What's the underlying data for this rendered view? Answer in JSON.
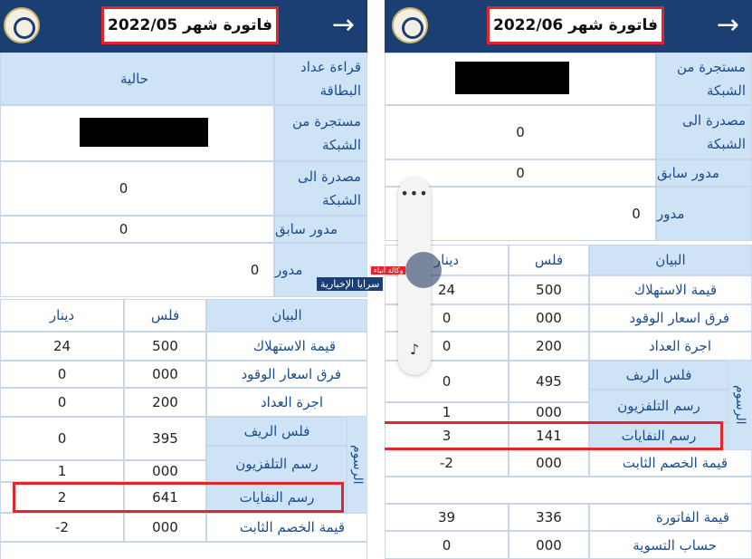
{
  "left": {
    "title": "فاتورة شهر 2022/05",
    "meter_reading_label": "قراءة عداد البطاقة",
    "meter_reading_value": "حالية",
    "consumed_label": "مستجرة من الشبكة",
    "exported_label": "مصدرة الى الشبكة",
    "exported_value": "0",
    "prev_rollover_label": "مدور سابق",
    "prev_rollover_value": "0",
    "rollover_label": "مدور",
    "rollover_value": "0",
    "headers": [
      "البيان",
      "فلس",
      "دينار"
    ],
    "rows": [
      {
        "label": "قيمة الاستهلاك",
        "fils": "500",
        "dinar": "24"
      },
      {
        "label": "فرق اسعار الوقود",
        "fils": "000",
        "dinar": "0"
      },
      {
        "label": "اجرة العداد",
        "fils": "200",
        "dinar": "0"
      },
      {
        "label": "فلس الريف",
        "fils": "395",
        "dinar": "0"
      },
      {
        "label": "رسم التلفزيون",
        "fils": "000",
        "dinar": "1"
      },
      {
        "label": "رسم النفايات",
        "fils": "641",
        "dinar": "2"
      },
      {
        "label": "قيمة الخصم الثابت",
        "fils": "000",
        "dinar": "-2"
      }
    ],
    "fees_group_label": "الرسوم"
  },
  "right": {
    "title": "فاتورة شهر 2022/06",
    "consumed_label": "مستجرة من الشبكة",
    "exported_label": "مصدرة الى الشبكة",
    "exported_value": "0",
    "prev_rollover_label": "مدور سابق",
    "prev_rollover_value": "0",
    "rollover_label": "مدور",
    "rollover_value": "0",
    "headers": [
      "البيان",
      "فلس",
      "دينار"
    ],
    "rows": [
      {
        "label": "قيمة الاستهلاك",
        "fils": "500",
        "dinar": "24"
      },
      {
        "label": "فرق اسعار الوقود",
        "fils": "000",
        "dinar": "0"
      },
      {
        "label": "اجرة العداد",
        "fils": "200",
        "dinar": "0"
      },
      {
        "label": "فلس الريف",
        "fils": "495",
        "dinar": "0"
      },
      {
        "label": "رسم التلفزيون",
        "fils": "000",
        "dinar": "1"
      },
      {
        "label": "رسم النفايات",
        "fils": "141",
        "dinar": "3"
      },
      {
        "label": "قيمة الخصم الثابت",
        "fils": "000",
        "dinar": "-2"
      },
      {
        "label": "قيمة الفاتورة",
        "fils": "336",
        "dinar": "39"
      },
      {
        "label": "حساب التسوية",
        "fils": "000",
        "dinar": "0"
      }
    ],
    "fees_group_label": "الرسوم"
  },
  "watermark": {
    "brand": "سرايا الإخبارية",
    "tag": "وكالة أنباء"
  },
  "colors": {
    "header": "#1c3f73",
    "label_bg": "#cfe3f6",
    "label_text": "#1b4d8c",
    "highlight": "#e2262a"
  }
}
